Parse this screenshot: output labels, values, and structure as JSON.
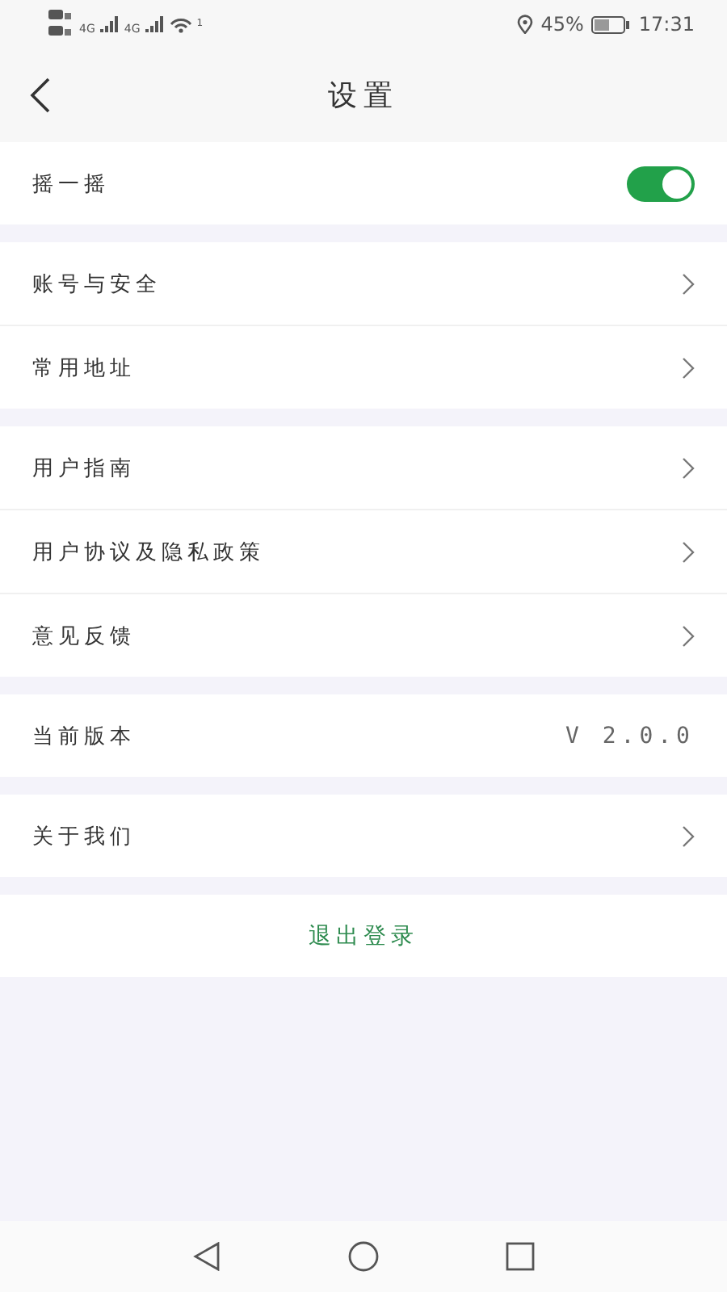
{
  "status_bar": {
    "networks": [
      "4G",
      "4G"
    ],
    "wifi_badge": "1",
    "battery": "45%",
    "time": "17:31"
  },
  "header": {
    "title": "设置"
  },
  "sections": [
    {
      "items": [
        {
          "kind": "toggle",
          "label": "摇一摇",
          "on": true
        }
      ]
    },
    {
      "items": [
        {
          "kind": "link",
          "label": "账号与安全"
        },
        {
          "kind": "link",
          "label": "常用地址"
        }
      ]
    },
    {
      "items": [
        {
          "kind": "link",
          "label": "用户指南"
        },
        {
          "kind": "link",
          "label": "用户协议及隐私政策"
        },
        {
          "kind": "link",
          "label": "意见反馈"
        }
      ]
    },
    {
      "items": [
        {
          "kind": "value",
          "label": "当前版本",
          "value": "V 2.0.0"
        }
      ]
    },
    {
      "items": [
        {
          "kind": "link",
          "label": "关于我们"
        }
      ]
    }
  ],
  "logout": "退出登录"
}
